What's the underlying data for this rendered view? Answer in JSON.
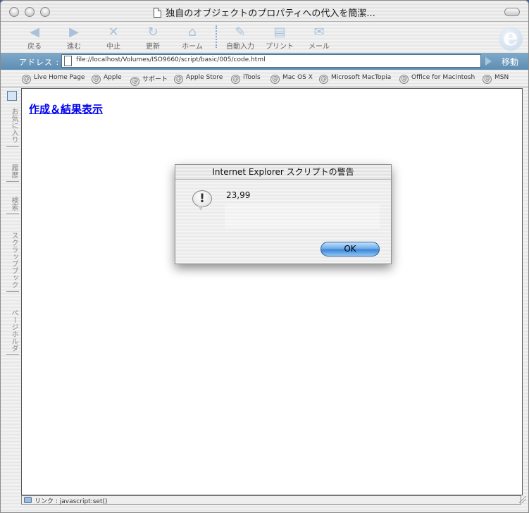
{
  "window": {
    "title": "独自のオブジェクトのプロパティへの代入を簡潔..."
  },
  "toolbar": {
    "back": "戻る",
    "forward": "進む",
    "stop": "中止",
    "refresh": "更新",
    "home": "ホーム",
    "autofill": "自動入力",
    "print": "プリント",
    "mail": "メール"
  },
  "address": {
    "label": "アドレス :",
    "url": "file://localhost/Volumes/ISO9660/script/basic/005/code.html",
    "go": "移動"
  },
  "links": [
    "Live Home Page",
    "Apple",
    "サポート",
    "Apple Store",
    "iTools",
    "Mac OS X",
    "Microsoft MacTopia",
    "Office for Macintosh",
    "MSN"
  ],
  "sidebar": {
    "tabs": [
      "お気に入り",
      "履歴",
      "検索",
      "スクラップブック",
      "ページホルダ"
    ]
  },
  "page": {
    "link_text": "作成＆結果表示"
  },
  "status": {
    "text": "リンク : javascript:set()"
  },
  "dialog": {
    "title": "Internet Explorer スクリプトの警告",
    "message": "23,99",
    "ok": "OK",
    "icon": "exclamation-icon"
  }
}
